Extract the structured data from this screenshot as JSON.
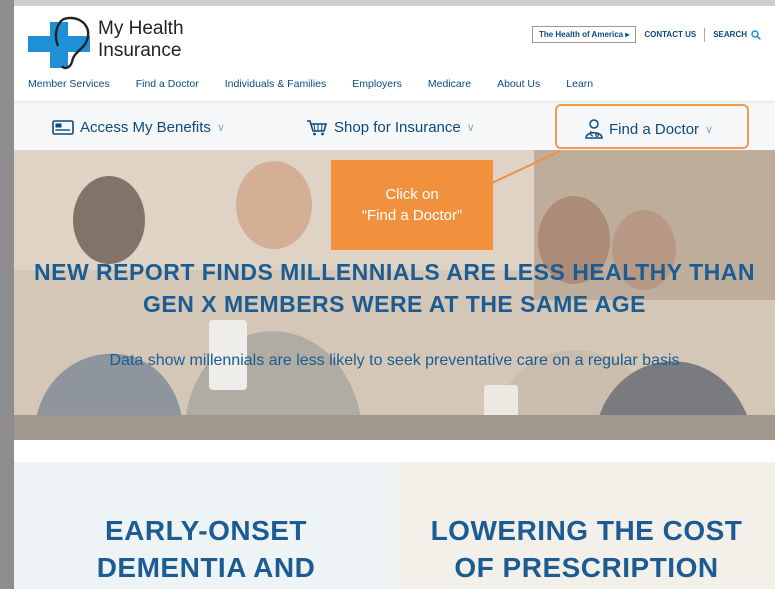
{
  "brand": {
    "line1": "My Health",
    "line2": "Insurance"
  },
  "utility": {
    "health_of_america": "The Health of America ▸",
    "contact": "CONTACT US",
    "search": "SEARCH"
  },
  "nav": [
    "Member Services",
    "Find a Doctor",
    "Individuals & Families",
    "Employers",
    "Medicare",
    "About Us",
    "Learn"
  ],
  "bar": {
    "benefits": "Access My Benefits",
    "shop": "Shop for Insurance",
    "doctor": "Find a Doctor"
  },
  "callout": {
    "line1": "Click on",
    "line2": "“Find a Doctor”"
  },
  "hero": {
    "headline1": "NEW REPORT FINDS MILLENNIALS ARE LESS HEALTHY THAN",
    "headline2": "GEN X MEMBERS WERE AT THE SAME AGE",
    "subtext": "Data show millennials are less likely to seek preventative care on a regular basis"
  },
  "cards": [
    {
      "line1": "EARLY-ONSET",
      "line2": "DEMENTIA AND"
    },
    {
      "line1": "LOWERING THE COST",
      "line2": "OF PRESCRIPTION"
    }
  ],
  "colors": {
    "brand_blue": "#0c4a7f",
    "logo_blue": "#1f8fd6",
    "accent_orange": "#f1913e",
    "highlight_border": "#f39a4d"
  }
}
